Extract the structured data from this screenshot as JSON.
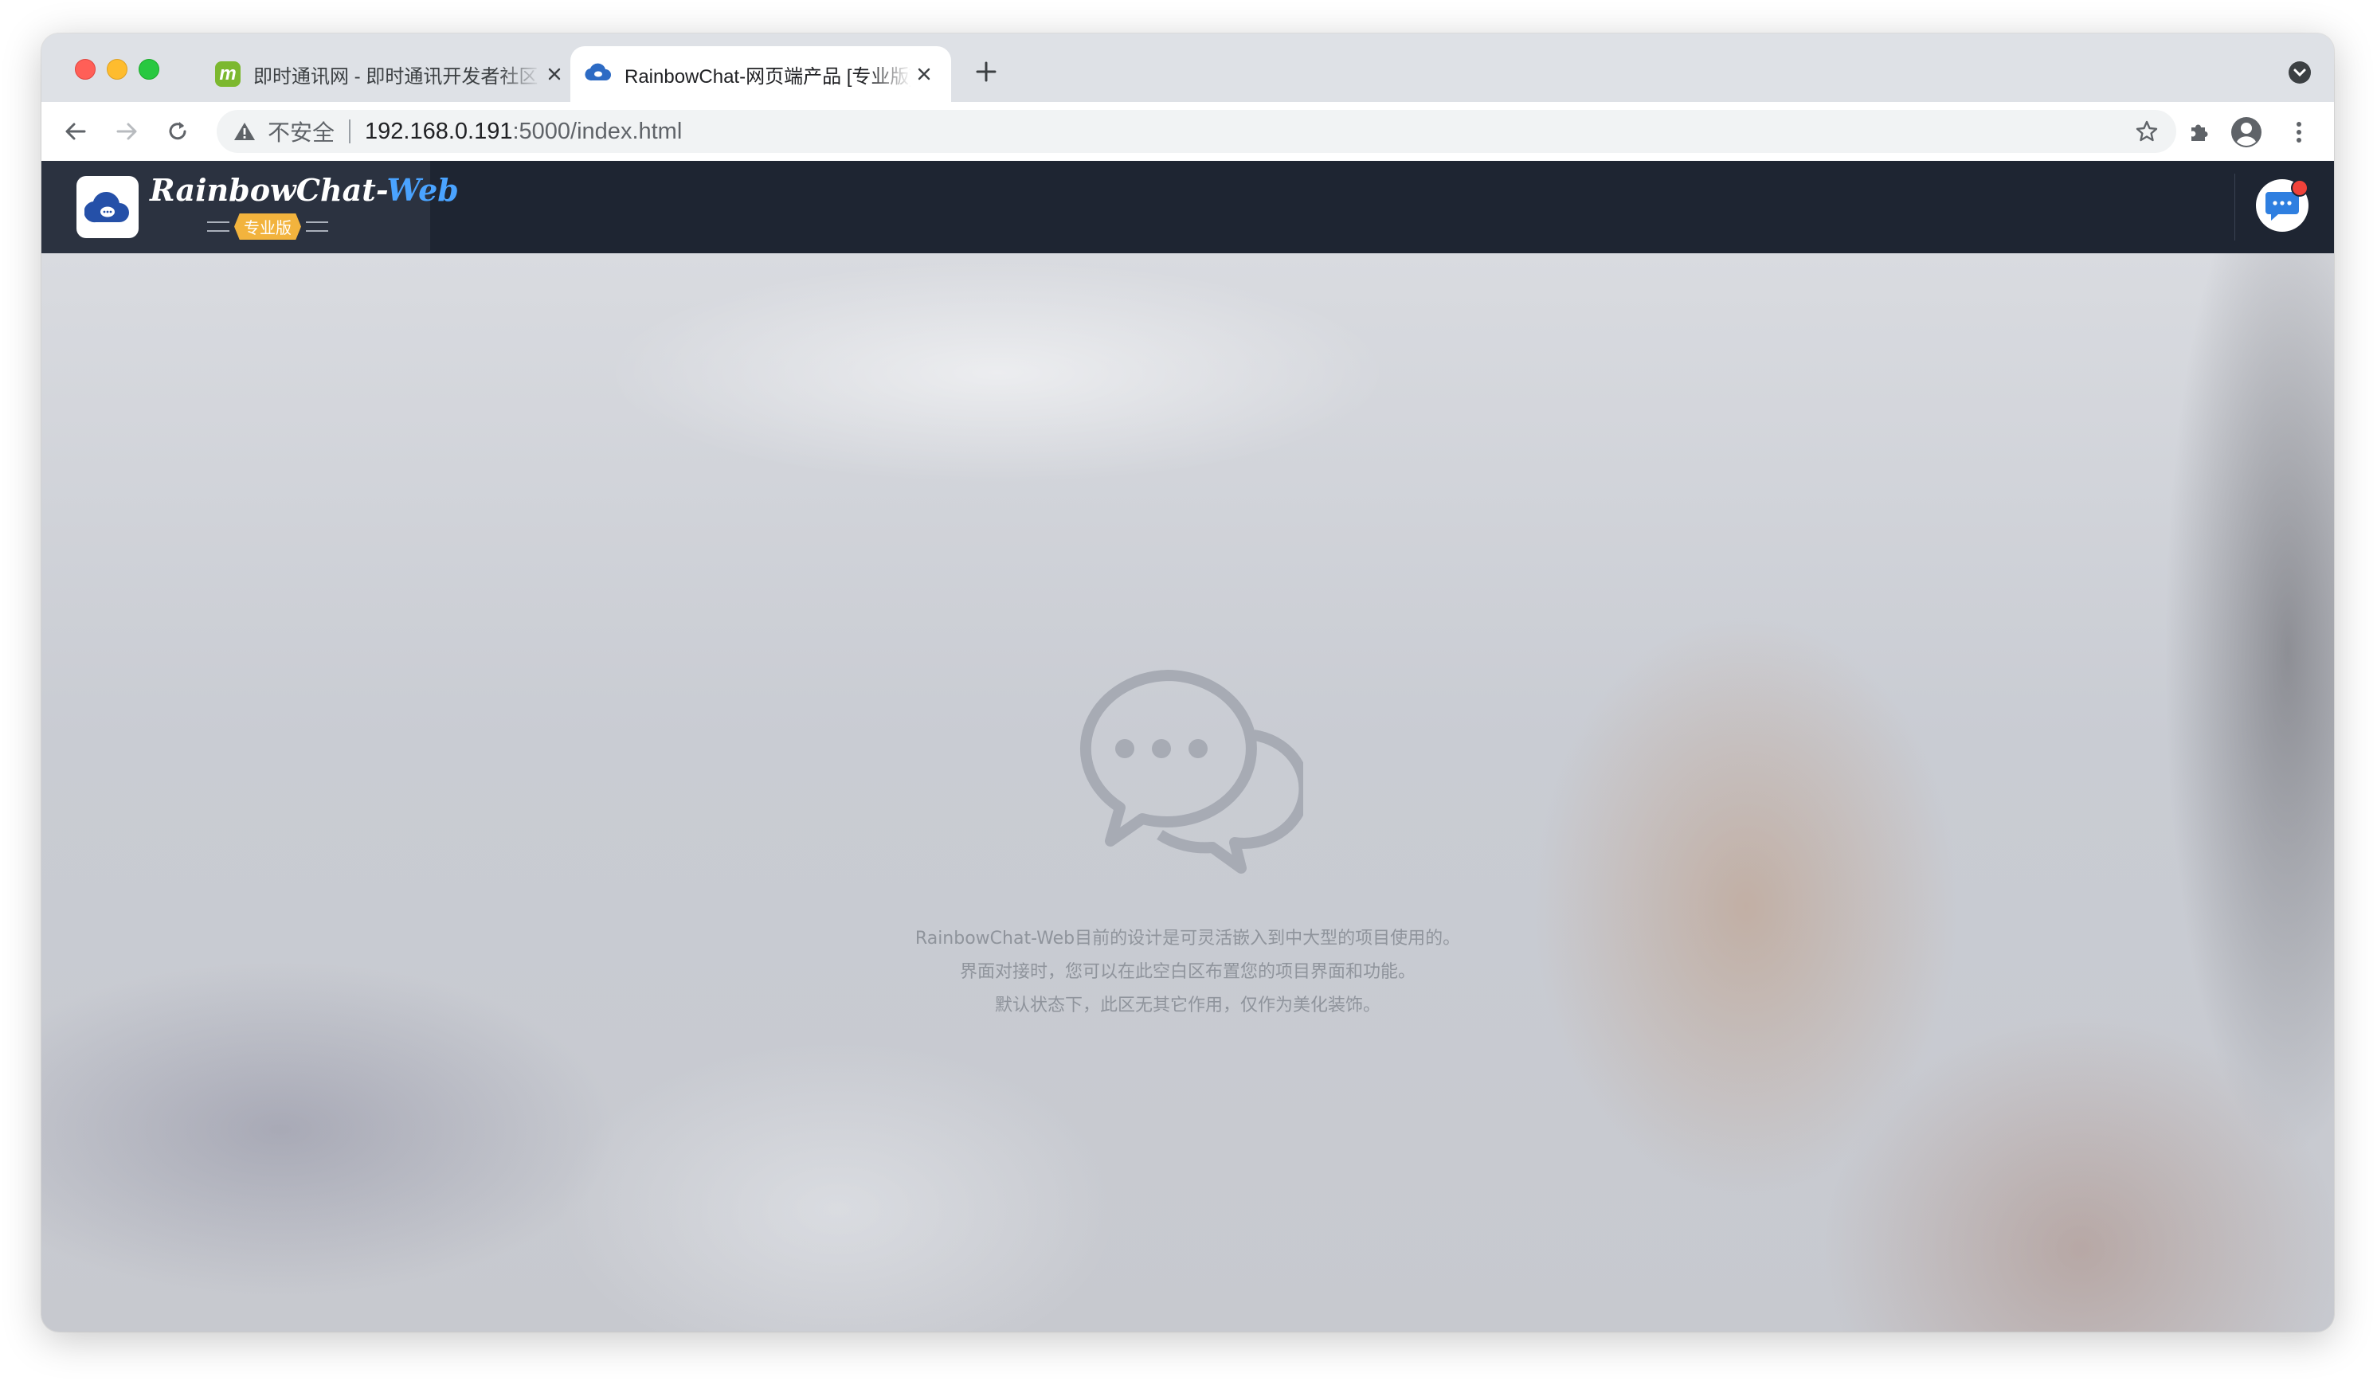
{
  "browser": {
    "tabs": [
      {
        "title": "即时通讯网 - 即时通讯开发者社区",
        "favicon": "m-logo-icon",
        "active": false
      },
      {
        "title": "RainbowChat-网页端产品 [专业版]",
        "favicon": "cloud-chat-icon",
        "active": true
      }
    ],
    "address": {
      "security_label": "不安全",
      "host": "192.168.0.191",
      "path": ":5000/index.html"
    }
  },
  "app": {
    "logo": {
      "name": "RainbowChat",
      "dash": "-",
      "suffix": "Web",
      "badge": "专业版"
    },
    "empty_state": {
      "lines": [
        "RainbowChat-Web目前的设计是可灵活嵌入到中大型的项目使用的。",
        "界面对接时，您可以在此空白区布置您的项目界面和功能。",
        "默认状态下，此区无其它作用，仅作为美化装饰。"
      ]
    }
  },
  "colors": {
    "appbar": "#1e2532",
    "logo_accent": "#4aa3ff",
    "badge": "#f2b33d",
    "notification_dot": "#f0423a"
  }
}
